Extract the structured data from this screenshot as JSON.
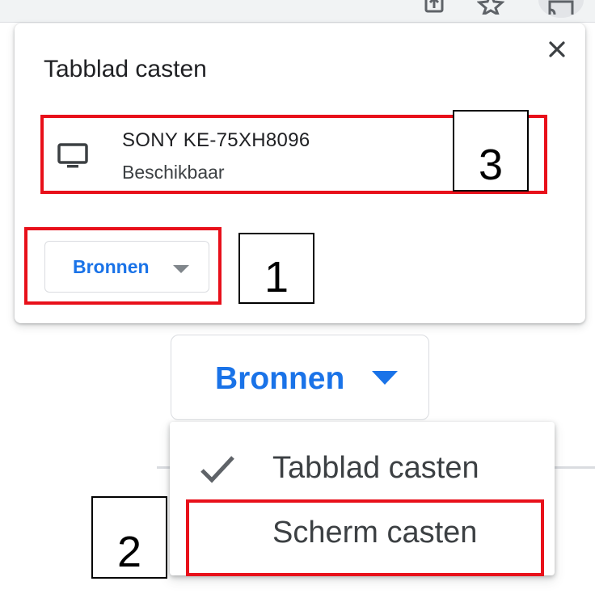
{
  "dialog": {
    "title": "Tabblad casten"
  },
  "device": {
    "name": "SONY KE-75XH8096",
    "status": "Beschikbaar",
    "icon": "monitor-icon"
  },
  "sources_button": {
    "label": "Bronnen"
  },
  "sources_menu": {
    "items": [
      {
        "label": "Tabblad casten",
        "checked": true
      },
      {
        "label": "Scherm casten",
        "checked": false
      }
    ]
  },
  "annotations": [
    "1",
    "2",
    "3"
  ],
  "colors": {
    "accent": "#1a73e8",
    "highlight": "#e8101a",
    "text": "#202124"
  }
}
